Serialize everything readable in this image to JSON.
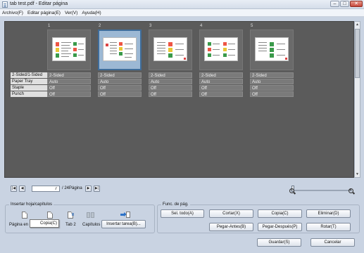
{
  "window": {
    "title": "tab test.pdf - Editar página"
  },
  "menu": [
    "Archivo(F)",
    "Editar página(E)",
    "Ver(V)",
    "Ayuda(H)"
  ],
  "properties": {
    "labels": [
      "2-Sided/1-Sided",
      "Paper Tray",
      "Staple",
      "Punch"
    ]
  },
  "pages": [
    {
      "number": "1",
      "values": [
        "2-Sided",
        "Auto",
        "Off",
        "Off"
      ],
      "selected": false
    },
    {
      "number": "2",
      "values": [
        "2-Sided",
        "Auto",
        "Off",
        "Off"
      ],
      "selected": true
    },
    {
      "number": "3",
      "values": [
        "2-Sided",
        "Auto",
        "Off",
        "Off"
      ],
      "selected": false
    },
    {
      "number": "4",
      "values": [
        "2-Sided",
        "Auto",
        "Off",
        "Off"
      ],
      "selected": false
    },
    {
      "number": "5",
      "values": [
        "2-Sided",
        "Auto",
        "Off",
        "Off"
      ],
      "selected": false
    }
  ],
  "navigation": {
    "current_page": "7",
    "total_label": "/ 24Página"
  },
  "insert_group": {
    "title": "Insertar hoja/capítulos",
    "page_label": "Página en b",
    "tooltip": "Copia(C)",
    "tab_label": "Tab 2",
    "chapters_label": "Capítulos",
    "insert_job_button": "Insertar tarea(B)..."
  },
  "page_functions": {
    "title": "Func. de pág.",
    "select_all": "Sel. todo(A)",
    "cut": "Cortar(X)",
    "copy": "Copia(C)",
    "delete": "Eliminar(D)",
    "paste_before": "Pegar-Antes(B)",
    "paste_after": "Pegar-Después(P)",
    "rotate": "Rotar(T)"
  },
  "footer": {
    "save": "Guardar(S)",
    "cancel": "Cancelar"
  },
  "icons": {
    "first": "first-page-icon",
    "prev": "prev-page-icon",
    "next": "next-page-icon",
    "last": "last-page-icon",
    "zoom_out": "zoom-out-icon",
    "zoom_in": "zoom-in-icon"
  },
  "zoom": {
    "level": 0.0
  },
  "colors": {
    "viewer_bg": "#5b5b5b",
    "selection": "#3f6d9b"
  }
}
